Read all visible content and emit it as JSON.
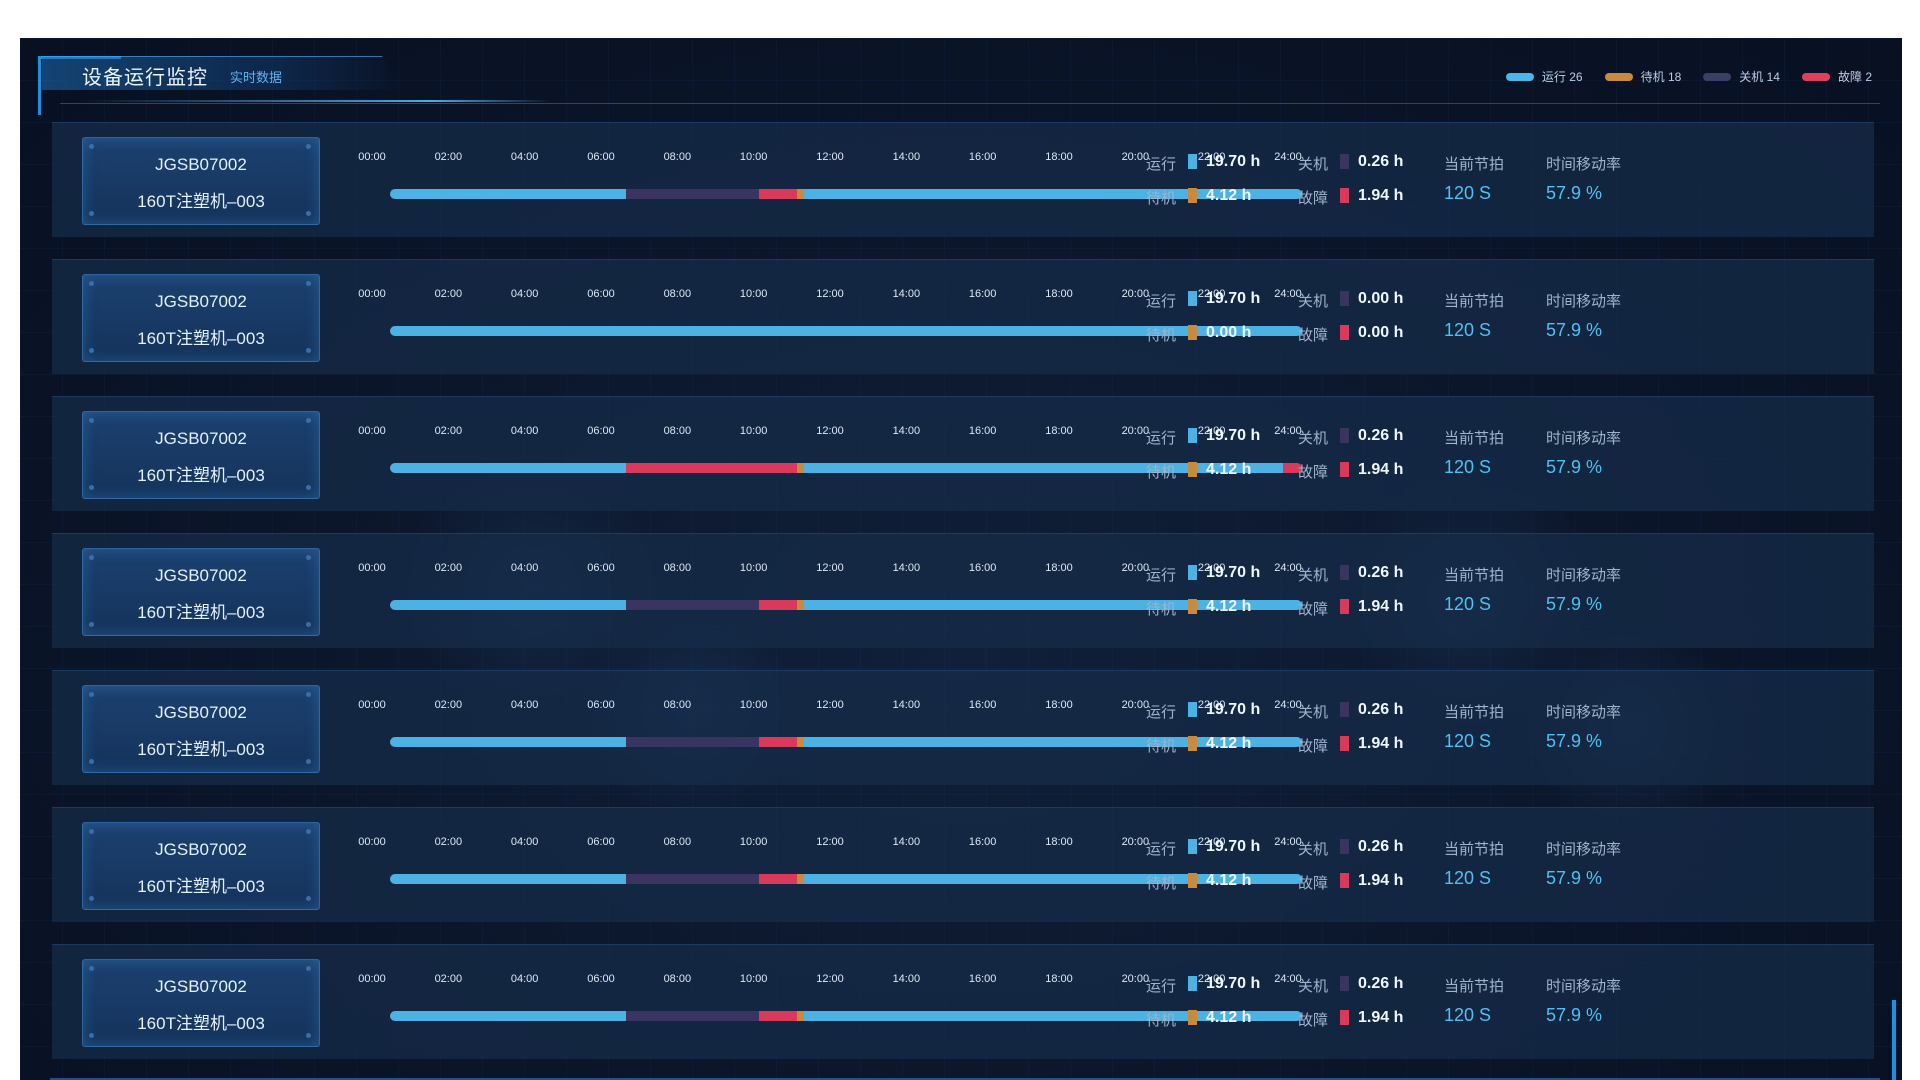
{
  "header": {
    "title": "设备运行监控",
    "subtitle": "实时数据"
  },
  "legend": [
    {
      "label": "运行 26",
      "color": "#4db6e8"
    },
    {
      "label": "待机 18",
      "color": "#c98a3e"
    },
    {
      "label": "关机 14",
      "color": "#3a3f66"
    },
    {
      "label": "故障 2",
      "color": "#e0405e"
    }
  ],
  "colors": {
    "run": "#4bb2e3",
    "standby": "#c98a3e",
    "off": "#3a3460",
    "fault": "#d93a5c",
    "accent": "#4fc0f3"
  },
  "time_ticks": [
    "00:00",
    "02:00",
    "04:00",
    "06:00",
    "08:00",
    "10:00",
    "12:00",
    "14:00",
    "16:00",
    "18:00",
    "20:00",
    "22:00",
    "24:00"
  ],
  "stat_labels": {
    "run": "运行",
    "standby": "待机",
    "off": "关机",
    "fault": "故障",
    "beat": "当前节拍",
    "rate": "时间移动率"
  },
  "machines": [
    {
      "code": "JGSB07002",
      "name": "160T注塑机–003",
      "run": "19.70 h",
      "standby": "4.12 h",
      "off": "0.26 h",
      "fault": "1.94 h",
      "beat": "120 S",
      "rate": "57.9 %",
      "timeline": [
        {
          "state": "run",
          "start": 0,
          "end": 6.2
        },
        {
          "state": "off",
          "start": 6.2,
          "end": 9.7
        },
        {
          "state": "fault",
          "start": 9.7,
          "end": 10.7
        },
        {
          "state": "standby",
          "start": 10.7,
          "end": 10.9
        },
        {
          "state": "run",
          "start": 10.9,
          "end": 24
        }
      ]
    },
    {
      "code": "JGSB07002",
      "name": "160T注塑机–003",
      "run": "19.70 h",
      "standby": "0.00 h",
      "off": "0.00 h",
      "fault": "0.00 h",
      "beat": "120 S",
      "rate": "57.9 %",
      "timeline": [
        {
          "state": "run",
          "start": 0,
          "end": 24
        }
      ]
    },
    {
      "code": "JGSB07002",
      "name": "160T注塑机–003",
      "run": "19.70 h",
      "standby": "4.12 h",
      "off": "0.26 h",
      "fault": "1.94 h",
      "beat": "120 S",
      "rate": "57.9 %",
      "timeline": [
        {
          "state": "run",
          "start": 0,
          "end": 6.2
        },
        {
          "state": "fault",
          "start": 6.2,
          "end": 10.7
        },
        {
          "state": "standby",
          "start": 10.7,
          "end": 10.9
        },
        {
          "state": "run",
          "start": 10.9,
          "end": 23.5
        },
        {
          "state": "fault",
          "start": 23.5,
          "end": 24
        }
      ]
    },
    {
      "code": "JGSB07002",
      "name": "160T注塑机–003",
      "run": "19.70 h",
      "standby": "4.12 h",
      "off": "0.26 h",
      "fault": "1.94 h",
      "beat": "120 S",
      "rate": "57.9 %",
      "timeline": [
        {
          "state": "run",
          "start": 0,
          "end": 6.2
        },
        {
          "state": "off",
          "start": 6.2,
          "end": 9.7
        },
        {
          "state": "fault",
          "start": 9.7,
          "end": 10.7
        },
        {
          "state": "standby",
          "start": 10.7,
          "end": 10.9
        },
        {
          "state": "run",
          "start": 10.9,
          "end": 24
        }
      ]
    },
    {
      "code": "JGSB07002",
      "name": "160T注塑机–003",
      "run": "19.70 h",
      "standby": "4.12 h",
      "off": "0.26 h",
      "fault": "1.94 h",
      "beat": "120 S",
      "rate": "57.9 %",
      "timeline": [
        {
          "state": "run",
          "start": 0,
          "end": 6.2
        },
        {
          "state": "off",
          "start": 6.2,
          "end": 9.7
        },
        {
          "state": "fault",
          "start": 9.7,
          "end": 10.7
        },
        {
          "state": "standby",
          "start": 10.7,
          "end": 10.9
        },
        {
          "state": "run",
          "start": 10.9,
          "end": 24
        }
      ]
    },
    {
      "code": "JGSB07002",
      "name": "160T注塑机–003",
      "run": "19.70 h",
      "standby": "4.12 h",
      "off": "0.26 h",
      "fault": "1.94 h",
      "beat": "120 S",
      "rate": "57.9 %",
      "timeline": [
        {
          "state": "run",
          "start": 0,
          "end": 6.2
        },
        {
          "state": "off",
          "start": 6.2,
          "end": 9.7
        },
        {
          "state": "fault",
          "start": 9.7,
          "end": 10.7
        },
        {
          "state": "standby",
          "start": 10.7,
          "end": 10.9
        },
        {
          "state": "run",
          "start": 10.9,
          "end": 24
        }
      ]
    },
    {
      "code": "JGSB07002",
      "name": "160T注塑机–003",
      "run": "19.70 h",
      "standby": "4.12 h",
      "off": "0.26 h",
      "fault": "1.94 h",
      "beat": "120 S",
      "rate": "57.9 %",
      "timeline": [
        {
          "state": "run",
          "start": 0,
          "end": 6.2
        },
        {
          "state": "off",
          "start": 6.2,
          "end": 9.7
        },
        {
          "state": "fault",
          "start": 9.7,
          "end": 10.7
        },
        {
          "state": "standby",
          "start": 10.7,
          "end": 10.9
        },
        {
          "state": "run",
          "start": 10.9,
          "end": 24
        }
      ]
    }
  ]
}
